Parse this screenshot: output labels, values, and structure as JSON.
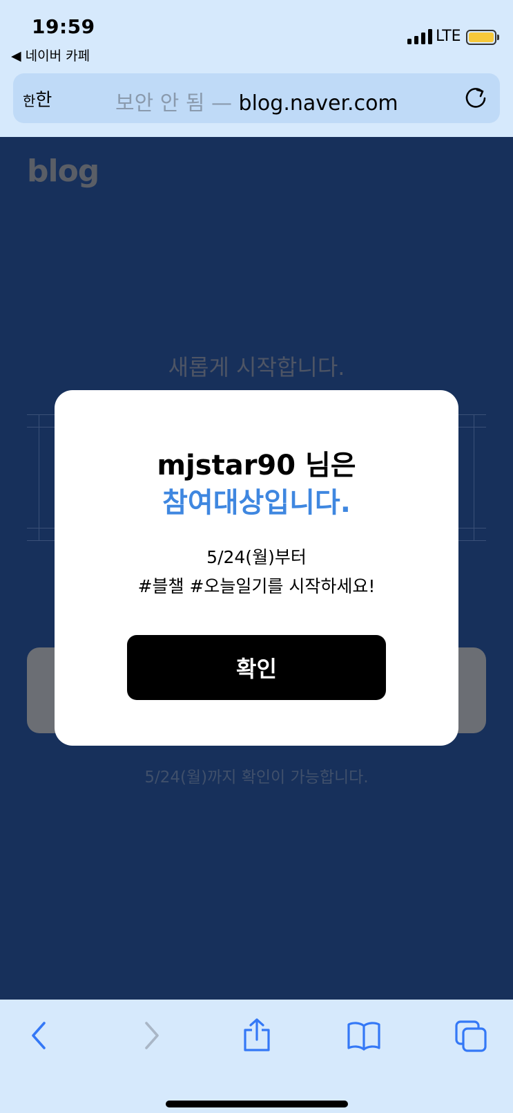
{
  "status": {
    "time": "19:59",
    "back_app": "◀ 네이버 카페",
    "network": "LTE"
  },
  "url_bar": {
    "aa_small": "한",
    "aa_large": "한",
    "security": "보안 안 됨 — ",
    "domain": "blog.naver.com"
  },
  "page": {
    "logo": "blog",
    "headline": "새롭게 시작합니다.",
    "footnote": "5/24(월)까지 확인이 가능합니다."
  },
  "modal": {
    "line1": "mjstar90 님은",
    "line2": "참여대상입니다.",
    "desc1": "5/24(월)부터",
    "desc2": "#블챌 #오늘일기를 시작하세요!",
    "confirm": "확인"
  },
  "colors": {
    "accent_blue": "#3f87e0",
    "page_bg": "#17305b",
    "chrome_bg": "#d6e9fc",
    "battery": "#f6c83b"
  },
  "toolbar": {
    "icons": [
      "back-icon",
      "forward-icon",
      "share-icon",
      "bookmarks-icon",
      "tabs-icon"
    ]
  }
}
